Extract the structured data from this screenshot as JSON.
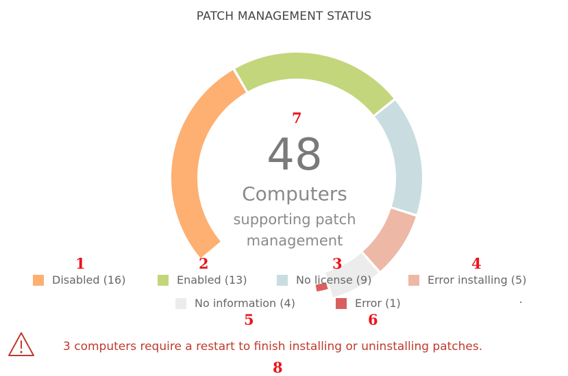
{
  "title": "PATCH MANAGEMENT STATUS",
  "total": "48",
  "center_label": "Computers",
  "center_sublabel_line1": "supporting patch",
  "center_sublabel_line2": "management",
  "legend": [
    {
      "label": "Disabled (16)",
      "color": "#fdb072",
      "value": 16
    },
    {
      "label": "Enabled (13)",
      "color": "#c3d67c",
      "value": 13
    },
    {
      "label": "No license (9)",
      "color": "#c9dde0",
      "value": 9
    },
    {
      "label": "Error installing (5)",
      "color": "#edb8a6",
      "value": 5
    },
    {
      "label": "No information (4)",
      "color": "#ececec",
      "value": 4
    },
    {
      "label": "Error (1)",
      "color": "#d96060",
      "value": 1
    }
  ],
  "callouts": [
    "1",
    "2",
    "3",
    "4",
    "5",
    "6",
    "7",
    "8"
  ],
  "warning_text": "3 computers require a restart to finish installing or uninstalling patches.",
  "warning_icon": "warning-triangle-icon",
  "stray_mark": "."
}
